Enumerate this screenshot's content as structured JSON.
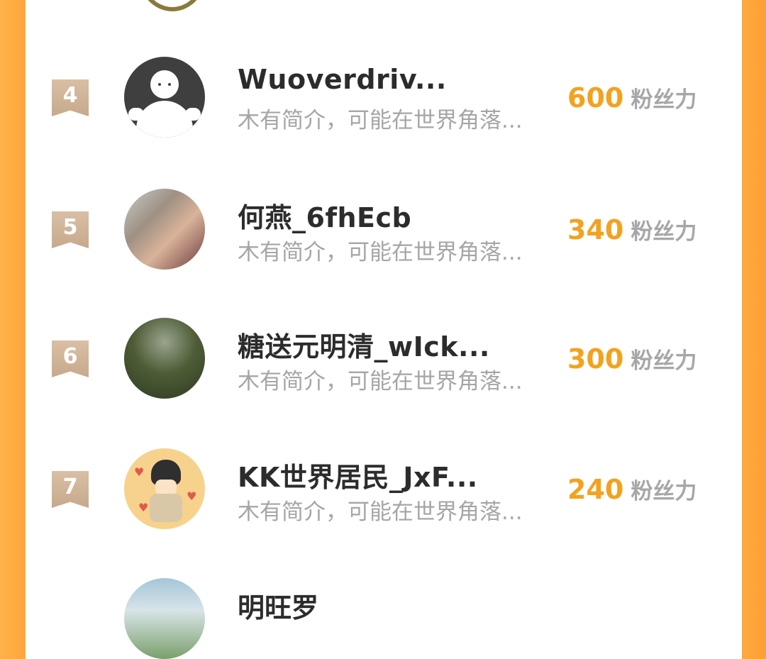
{
  "leaderboard": {
    "items": [
      {
        "rank": "4",
        "name": "Wuoverdriv...",
        "bio": "木有简介，可能在世界角落...",
        "score": "600",
        "unit": "粉丝力",
        "avatar": "default-avatar"
      },
      {
        "rank": "5",
        "name": "何燕_6fhEcb",
        "bio": "木有简介，可能在世界角落...",
        "score": "340",
        "unit": "粉丝力",
        "avatar": "photo-avatar"
      },
      {
        "rank": "6",
        "name": "糖送元明清_wIck...",
        "bio": "木有简介，可能在世界角落...",
        "score": "300",
        "unit": "粉丝力",
        "avatar": "photo-avatar"
      },
      {
        "rank": "7",
        "name": "KK世界居民_JxF...",
        "bio": "木有简介，可能在世界角落...",
        "score": "240",
        "unit": "粉丝力",
        "avatar": "cartoon-avatar"
      }
    ],
    "partial_next_name": "明旺罗"
  },
  "colors": {
    "accent": "#f3a21f",
    "frame": "#ffa63a",
    "rank_badge": "#d2b79c",
    "name": "#2c2c2c",
    "muted": "#a6a6a6"
  }
}
